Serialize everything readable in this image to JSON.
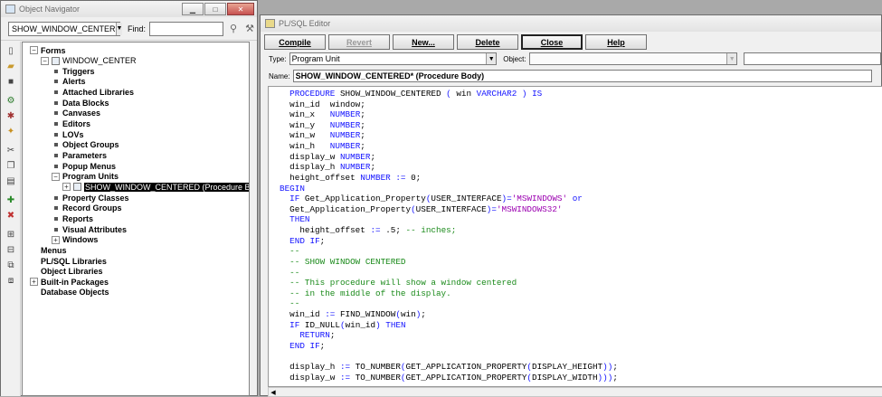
{
  "navigator": {
    "title": "Object Navigator",
    "module_select": "SHOW_WINDOW_CENTER",
    "find_label": "Find:",
    "tree": [
      {
        "label": "Forms",
        "depth": 0,
        "expander": "−",
        "style": "bold"
      },
      {
        "label": "WINDOW_CENTER",
        "depth": 1,
        "expander": "−",
        "style": "normal"
      },
      {
        "label": "Triggers",
        "depth": 2,
        "expander": "",
        "style": "bold"
      },
      {
        "label": "Alerts",
        "depth": 2,
        "expander": "",
        "style": "bold"
      },
      {
        "label": "Attached Libraries",
        "depth": 2,
        "expander": "",
        "style": "bold"
      },
      {
        "label": "Data Blocks",
        "depth": 2,
        "expander": "",
        "style": "bold"
      },
      {
        "label": "Canvases",
        "depth": 2,
        "expander": "",
        "style": "bold"
      },
      {
        "label": "Editors",
        "depth": 2,
        "expander": "",
        "style": "bold"
      },
      {
        "label": "LOVs",
        "depth": 2,
        "expander": "",
        "style": "bold"
      },
      {
        "label": "Object Groups",
        "depth": 2,
        "expander": "",
        "style": "bold"
      },
      {
        "label": "Parameters",
        "depth": 2,
        "expander": "",
        "style": "bold"
      },
      {
        "label": "Popup Menus",
        "depth": 2,
        "expander": "",
        "style": "bold"
      },
      {
        "label": "Program Units",
        "depth": 2,
        "expander": "−",
        "style": "bold"
      },
      {
        "label": "SHOW_WINDOW_CENTERED (Procedure Body",
        "depth": 3,
        "expander": "+",
        "style": "selected"
      },
      {
        "label": "Property Classes",
        "depth": 2,
        "expander": "",
        "style": "bold"
      },
      {
        "label": "Record Groups",
        "depth": 2,
        "expander": "",
        "style": "bold"
      },
      {
        "label": "Reports",
        "depth": 2,
        "expander": "",
        "style": "bold"
      },
      {
        "label": "Visual Attributes",
        "depth": 2,
        "expander": "",
        "style": "bold"
      },
      {
        "label": "Windows",
        "depth": 2,
        "expander": "+",
        "style": "bold"
      },
      {
        "label": "Menus",
        "depth": 0,
        "expander": "",
        "style": "bold"
      },
      {
        "label": "PL/SQL Libraries",
        "depth": 0,
        "expander": "",
        "style": "bold"
      },
      {
        "label": "Object Libraries",
        "depth": 0,
        "expander": "",
        "style": "bold"
      },
      {
        "label": "Built-in Packages",
        "depth": 0,
        "expander": "+",
        "style": "bold"
      },
      {
        "label": "Database Objects",
        "depth": 0,
        "expander": "",
        "style": "bold"
      }
    ]
  },
  "editor": {
    "title": "PL/SQL Editor",
    "buttons": {
      "compile": "Compile",
      "revert": "Revert",
      "new": "New...",
      "delete": "Delete",
      "close": "Close",
      "help": "Help"
    },
    "type_label": "Type:",
    "type_value": "Program Unit",
    "object_label": "Object:",
    "object_value": "",
    "name_label": "Name:",
    "name_value": "SHOW_WINDOW_CENTERED* (Procedure Body)",
    "code": [
      [
        [
          "  ",
          ""
        ],
        [
          "PROCEDURE",
          "kw"
        ],
        [
          " SHOW_WINDOW_CENTERED ",
          ""
        ],
        [
          "(",
          "kw"
        ],
        [
          " win ",
          ""
        ],
        [
          "VARCHAR2",
          "kw"
        ],
        [
          " ",
          ""
        ],
        [
          ")",
          "kw"
        ],
        [
          " ",
          ""
        ],
        [
          "IS",
          "kw"
        ]
      ],
      [
        [
          "  win_id  window;",
          ""
        ]
      ],
      [
        [
          "  win_x   ",
          ""
        ],
        [
          "NUMBER",
          "kw"
        ],
        [
          ";",
          ""
        ]
      ],
      [
        [
          "  win_y   ",
          ""
        ],
        [
          "NUMBER",
          "kw"
        ],
        [
          ";",
          ""
        ]
      ],
      [
        [
          "  win_w   ",
          ""
        ],
        [
          "NUMBER",
          "kw"
        ],
        [
          ";",
          ""
        ]
      ],
      [
        [
          "  win_h   ",
          ""
        ],
        [
          "NUMBER",
          "kw"
        ],
        [
          ";",
          ""
        ]
      ],
      [
        [
          "  display_w ",
          ""
        ],
        [
          "NUMBER",
          "kw"
        ],
        [
          ";",
          ""
        ]
      ],
      [
        [
          "  display_h ",
          ""
        ],
        [
          "NUMBER",
          "kw"
        ],
        [
          ";",
          ""
        ]
      ],
      [
        [
          "  height_offset ",
          ""
        ],
        [
          "NUMBER",
          "kw"
        ],
        [
          " ",
          ""
        ],
        [
          ":=",
          "kw"
        ],
        [
          " 0;",
          ""
        ]
      ],
      [
        [
          "BEGIN",
          "kw"
        ]
      ],
      [
        [
          "  ",
          ""
        ],
        [
          "IF",
          "kw"
        ],
        [
          " Get_Application_Property",
          ""
        ],
        [
          "(",
          "kw"
        ],
        [
          "USER_INTERFACE",
          ""
        ],
        [
          ")",
          "kw"
        ],
        [
          "=",
          "kw"
        ],
        [
          "'MSWINDOWS'",
          "st"
        ],
        [
          " ",
          ""
        ],
        [
          "or",
          "kw"
        ]
      ],
      [
        [
          "  Get_Application_Property",
          ""
        ],
        [
          "(",
          "kw"
        ],
        [
          "USER_INTERFACE",
          ""
        ],
        [
          ")",
          "kw"
        ],
        [
          "=",
          "kw"
        ],
        [
          "'MSWINDOWS32'",
          "st"
        ]
      ],
      [
        [
          "  ",
          ""
        ],
        [
          "THEN",
          "kw"
        ]
      ],
      [
        [
          "    height_offset ",
          ""
        ],
        [
          ":=",
          "kw"
        ],
        [
          " .5; ",
          ""
        ],
        [
          "-- inches;",
          "cm"
        ]
      ],
      [
        [
          "  ",
          ""
        ],
        [
          "END IF",
          "kw"
        ],
        [
          ";",
          ""
        ]
      ],
      [
        [
          "  --",
          "cm"
        ]
      ],
      [
        [
          "  -- SHOW WINDOW CENTERED",
          "cm"
        ]
      ],
      [
        [
          "  --",
          "cm"
        ]
      ],
      [
        [
          "  -- This procedure will show a window centered",
          "cm"
        ]
      ],
      [
        [
          "  -- in the middle of the display.",
          "cm"
        ]
      ],
      [
        [
          "  --",
          "cm"
        ]
      ],
      [
        [
          "  win_id ",
          ""
        ],
        [
          ":=",
          "kw"
        ],
        [
          " FIND_WINDOW",
          ""
        ],
        [
          "(",
          "kw"
        ],
        [
          "win",
          ""
        ],
        [
          ")",
          "kw"
        ],
        [
          ";",
          ""
        ]
      ],
      [
        [
          "  ",
          ""
        ],
        [
          "IF",
          "kw"
        ],
        [
          " ID_NULL",
          ""
        ],
        [
          "(",
          "kw"
        ],
        [
          "win_id",
          ""
        ],
        [
          ")",
          "kw"
        ],
        [
          " ",
          ""
        ],
        [
          "THEN",
          "kw"
        ]
      ],
      [
        [
          "    ",
          ""
        ],
        [
          "RETURN",
          "kw"
        ],
        [
          ";",
          ""
        ]
      ],
      [
        [
          "  ",
          ""
        ],
        [
          "END IF",
          "kw"
        ],
        [
          ";",
          ""
        ]
      ],
      [
        [
          "",
          ""
        ]
      ],
      [
        [
          "  display_h ",
          ""
        ],
        [
          ":=",
          "kw"
        ],
        [
          " TO_NUMBER",
          ""
        ],
        [
          "(",
          "kw"
        ],
        [
          "GET_APPLICATION_PROPERTY",
          ""
        ],
        [
          "(",
          "kw"
        ],
        [
          "DISPLAY_HEIGHT",
          ""
        ],
        [
          ")",
          "kw"
        ],
        [
          ")",
          "kw"
        ],
        [
          ";",
          ""
        ]
      ],
      [
        [
          "  display_w ",
          ""
        ],
        [
          ":=",
          "kw"
        ],
        [
          " TO_NUMBER",
          ""
        ],
        [
          "(",
          "kw"
        ],
        [
          "GET_APPLICATION_PROPERTY",
          ""
        ],
        [
          "(",
          "kw"
        ],
        [
          "DISPLAY_WIDTH",
          ""
        ],
        [
          ")",
          "kw"
        ],
        [
          ")",
          "kw"
        ],
        [
          ")",
          "kw"
        ],
        [
          ";",
          ""
        ]
      ]
    ]
  }
}
